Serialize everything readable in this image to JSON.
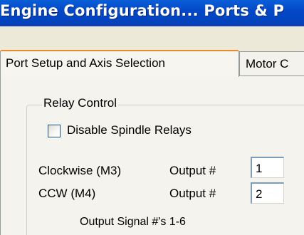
{
  "window": {
    "title": "Engine Configuration... Ports & P"
  },
  "tabs": [
    {
      "label": "Port Setup and Axis Selection",
      "active": true
    },
    {
      "label": "Motor C",
      "active": false
    }
  ],
  "relay_control": {
    "legend": "Relay Control",
    "disable_spindle_relays": {
      "label": "Disable Spindle Relays",
      "checked": false
    },
    "rows": [
      {
        "label": "Clockwise (M3)",
        "output_label": "Output #",
        "value": "1"
      },
      {
        "label": "CCW (M4)",
        "output_label": "Output #",
        "value": "2"
      }
    ],
    "caption": "Output Signal #'s 1-6"
  },
  "colors": {
    "titlebar": "#0348c9",
    "active_tab_highlight": "#e68b2c",
    "panel": "#f4f3ee"
  }
}
